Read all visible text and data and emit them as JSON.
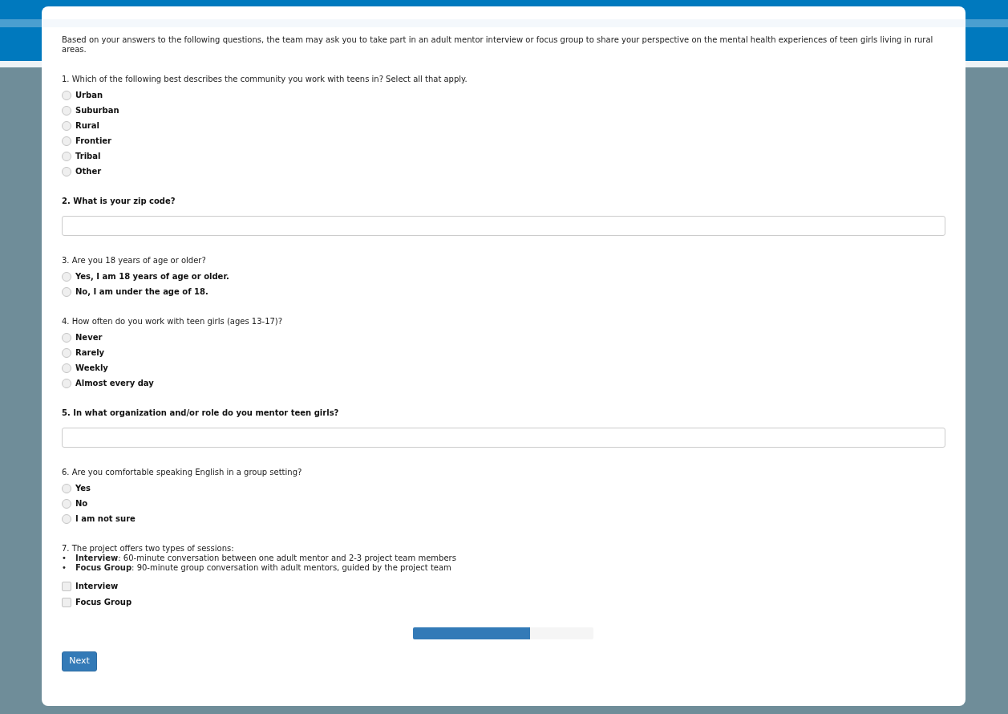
{
  "intro": "Based on your answers to the following questions, the team may ask you to take part in an adult mentor interview or focus group to share your perspective on the mental health experiences of teen girls living in rural areas.",
  "questions": [
    {
      "kind": "radio",
      "prompt": "1. Which of the following best describes the community you work with teens in? Select all that apply.",
      "options": [
        {
          "label": "Urban",
          "selected": false
        },
        {
          "label": "Suburban",
          "selected": false
        },
        {
          "label": "Rural",
          "selected": false
        },
        {
          "label": "Frontier",
          "selected": false
        },
        {
          "label": "Tribal",
          "selected": false
        },
        {
          "label": "Other",
          "selected": false
        }
      ]
    },
    {
      "kind": "text",
      "prompt": "2. What is your zip code?"
    },
    {
      "kind": "radio",
      "prompt": "3. Are you 18 years of age or older?",
      "options": [
        {
          "label": "Yes, I am 18 years of age or older.",
          "selected": false
        },
        {
          "label": "No, I am under the age of 18.",
          "selected": false
        }
      ]
    },
    {
      "kind": "radio",
      "prompt": "4. How often do you work with teen girls (ages 13-17)?",
      "options": [
        {
          "label": "Never",
          "selected": false
        },
        {
          "label": "Rarely",
          "selected": false
        },
        {
          "label": "Weekly",
          "selected": false
        },
        {
          "label": "Almost every day",
          "selected": false
        }
      ]
    },
    {
      "kind": "text",
      "prompt": "5. In what organization and/or role do you mentor teen girls?"
    },
    {
      "kind": "radio",
      "prompt": "6. Are you comfortable speaking English in a group setting?",
      "options": [
        {
          "label": "Yes",
          "selected": false
        },
        {
          "label": "No",
          "selected": false
        },
        {
          "label": "I am not sure",
          "selected": false
        }
      ]
    },
    {
      "kind": "checkbox",
      "prompt": "7. The project offers two types of sessions:",
      "bullets": [
        {
          "marker": "•",
          "text": "**Interview**: 60-minute conversation between one adult mentor and 2-3 project team members"
        },
        {
          "marker": "•",
          "text": "**Focus Group**: 90-minute group conversation with adult mentors, guided by the project team"
        }
      ],
      "options": [
        {
          "label": "Interview",
          "checked": false
        },
        {
          "label": "Focus Group",
          "checked": false
        }
      ]
    }
  ],
  "progress": {
    "level": 0.65
  },
  "next_button": "Next"
}
